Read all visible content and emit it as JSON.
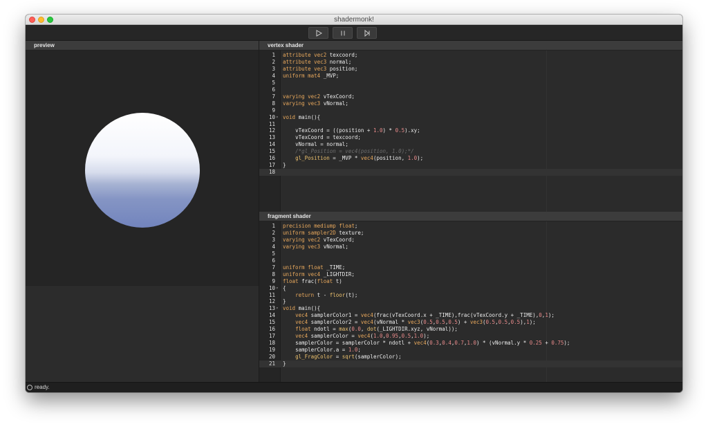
{
  "window": {
    "title": "shadermonk!"
  },
  "toolbar": {
    "play_icon": "play-icon",
    "pause_icon": "pause-icon",
    "step_icon": "step-forward-icon"
  },
  "preview": {
    "header": "preview"
  },
  "vertex": {
    "header": "vertex shader",
    "lines": [
      "attribute vec2 texcoord;",
      "attribute vec3 normal;",
      "attribute vec3 position;",
      "uniform mat4 _MVP;",
      "",
      "",
      "varying vec2 vTexCoord;",
      "varying vec3 vNormal;",
      "",
      "void main(){",
      "",
      "    vTexCoord = ((position + 1.0) * 0.5).xy;",
      "    vTexCoord = texcoord;",
      "    vNormal = normal;",
      "    /*gl_Position = vec4(position, 1.0);*/",
      "    gl_Position = _MVP * vec4(position, 1.0);",
      "}",
      ""
    ]
  },
  "fragment": {
    "header": "fragment shader",
    "lines": [
      "precision mediump float;",
      "uniform sampler2D texture;",
      "varying vec2 vTexCoord;",
      "varying vec3 vNormal;",
      "",
      "",
      "uniform float _TIME;",
      "uniform vec4 _LIGHTDIR;",
      "float frac(float t)",
      "{",
      "    return t - floor(t);",
      "}",
      "void main(){",
      "    vec4 samplerColor1 = vec4(frac(vTexCoord.x + _TIME),frac(vTexCoord.y + _TIME),0,1);",
      "    vec4 samplerColor2 = vec4(vNormal * vec3(0.5,0.5,0.5) + vec3(0.5,0.5,0.5),1);",
      "    float ndotl = max(0.0, dot(_LIGHTDIR.xyz, vNormal));",
      "    vec4 samplerColor = vec4(1.0,0.95,0.5,1.0);",
      "    samplerColor = samplerColor * ndotl + vec4(0.3,0.4,0.7,1.0) * (vNormal.y * 0.25 + 0.75);",
      "    samplerColor.a = 1.0;",
      "    gl_FragColor = sqrt(samplerColor);",
      "}"
    ]
  },
  "status": {
    "text": "ready."
  },
  "colors": {
    "keyword": "#e8a85c",
    "number": "#e88a8a",
    "builtin": "#ecc16e",
    "comment": "#6d6d6d",
    "text": "#ececec"
  }
}
